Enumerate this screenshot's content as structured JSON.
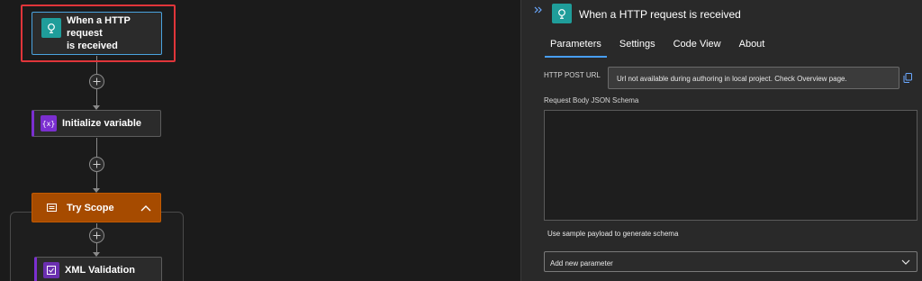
{
  "canvas": {
    "trigger": {
      "title_line1": "When a HTTP request",
      "title_line2": "is received",
      "icon": "http-request-icon"
    },
    "initialize_variable": {
      "title": "Initialize variable",
      "icon": "variable-icon"
    },
    "try_scope": {
      "title": "Try Scope",
      "icon": "scope-icon"
    },
    "xml_validation": {
      "title": "XML Validation",
      "icon": "xml-validation-icon"
    }
  },
  "panel": {
    "title": "When a HTTP request is received",
    "tabs": [
      {
        "label": "Parameters",
        "active": true
      },
      {
        "label": "Settings",
        "active": false
      },
      {
        "label": "Code View",
        "active": false
      },
      {
        "label": "About",
        "active": false
      }
    ],
    "http_post_url_label": "HTTP POST URL",
    "http_post_url_value": "Url not available during authoring in local project. Check Overview page.",
    "schema_label": "Request Body JSON Schema",
    "sample_payload_link": "Use sample payload to generate schema",
    "add_parameter_placeholder": "Add new parameter"
  },
  "colors": {
    "canvas_bg": "#1b1b1b",
    "panel_bg": "#292929",
    "trigger_teal": "#1f9d9a",
    "variable_purple": "#7b2fd0",
    "scope_orange": "#a64b00",
    "selection_red": "#e0353a",
    "accent_blue": "#479ef5"
  }
}
